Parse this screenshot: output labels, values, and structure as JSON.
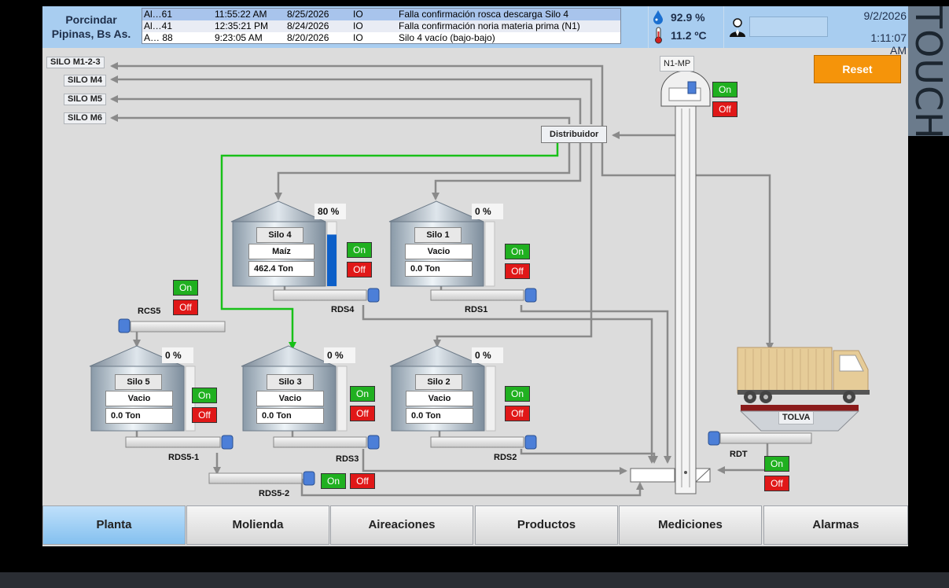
{
  "header": {
    "site_line1": "Porcindar",
    "site_line2": "Pipinas, Bs As.",
    "alarms": [
      {
        "id": "Al…61",
        "time": "11:55:22 AM",
        "date": "8/25/2026",
        "type": "IO",
        "text": "Falla confirmación rosca descarga Silo 4"
      },
      {
        "id": "Al…41",
        "time": "12:35:21 PM",
        "date": "8/24/2026",
        "type": "IO",
        "text": "Falla confirmación noria materia prima (N1)"
      },
      {
        "id": "A… 88",
        "time": "9:23:05 AM",
        "date": "8/20/2026",
        "type": "IO",
        "text": "Silo 4 vacío (bajo-bajo)"
      }
    ],
    "humidity": "92.9 %",
    "temperature": "11.2 ºC",
    "date": "9/2/2026",
    "time": "1:11:07 AM"
  },
  "brand": "TOUCH",
  "destinations": [
    "SILO M1-2-3",
    "SILO M4",
    "SILO M5",
    "SILO M6"
  ],
  "distributor": "Distribuidor",
  "elevator": "N1-MP",
  "reset_label": "Reset",
  "on_label": "On",
  "off_label": "Off",
  "silos": {
    "silo4": {
      "name": "Silo 4",
      "product": "Maíz",
      "tons": "462.4 Ton",
      "pct": "80 %",
      "level": 0.8
    },
    "silo1": {
      "name": "Silo 1",
      "product": "Vacio",
      "tons": "0.0 Ton",
      "pct": "0 %",
      "level": 0
    },
    "silo5": {
      "name": "Silo 5",
      "product": "Vacio",
      "tons": "0.0 Ton",
      "pct": "0 %",
      "level": 0
    },
    "silo3": {
      "name": "Silo 3",
      "product": "Vacio",
      "tons": "0.0 Ton",
      "pct": "0 %",
      "level": 0
    },
    "silo2": {
      "name": "Silo 2",
      "product": "Vacio",
      "tons": "0.0 Ton",
      "pct": "0 %",
      "level": 0
    }
  },
  "conveyors": {
    "rds4": "RDS4",
    "rds1": "RDS1",
    "rcs5": "RCS5",
    "rds5_1": "RDS5-1",
    "rds3": "RDS3",
    "rds2": "RDS2",
    "rds5_2": "RDS5-2",
    "rdt": "RDT"
  },
  "tolva": "TOLVA",
  "colors": {
    "pipe": "#8a8a8a",
    "active_flow": "#18c018",
    "on": "#20b020",
    "off": "#e01818",
    "accent": "#f5940a"
  },
  "nav": [
    "Planta",
    "Molienda",
    "Aireaciones",
    "Productos",
    "Mediciones",
    "Alarmas"
  ],
  "nav_active": "Planta"
}
